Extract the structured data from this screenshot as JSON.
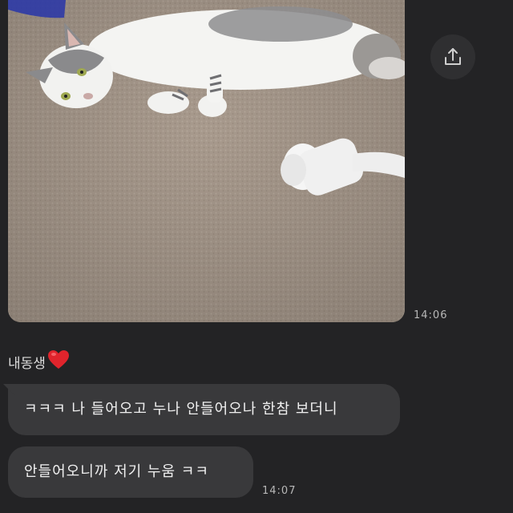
{
  "photo": {
    "alt": "photo",
    "time": "14:06"
  },
  "share": {
    "icon": "share-icon"
  },
  "sender": {
    "name": "내동생",
    "emoji": "heart-icon",
    "emoji_color": "#e0242c"
  },
  "messages": [
    {
      "text": "ㅋㅋㅋ 나 들어오고 누나 안들어오나 한참 보더니"
    },
    {
      "text": "안들어오니까 저기 누움 ㅋㅋ"
    }
  ],
  "last_time": "14:07",
  "colors": {
    "background": "#232325",
    "bubble": "#39393b",
    "text": "#f0f0f0",
    "timestamp": "#b8b8b8"
  }
}
